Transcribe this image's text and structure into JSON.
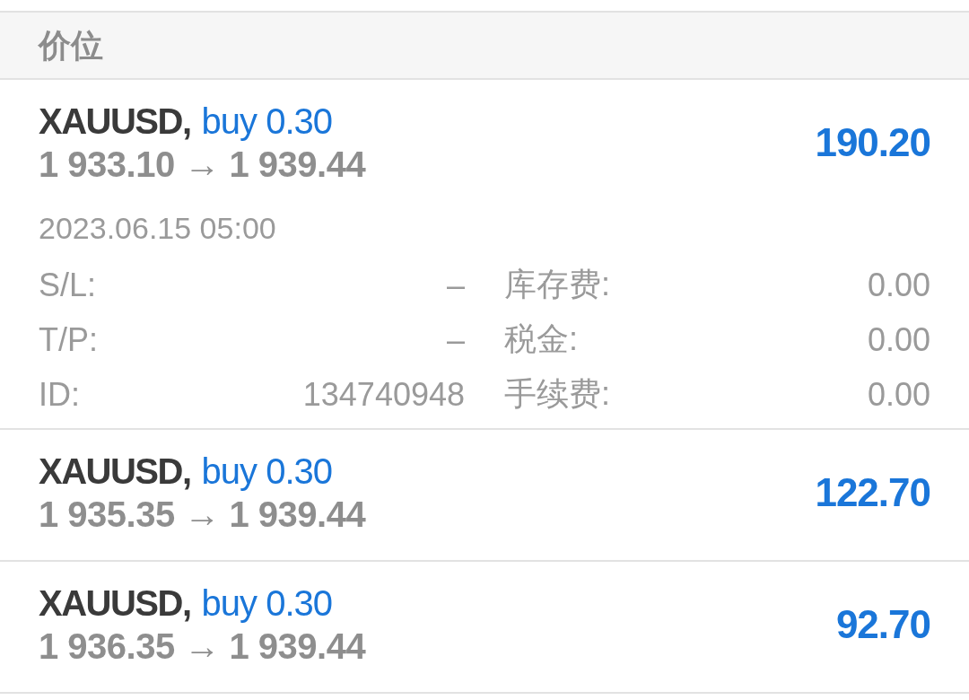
{
  "section": {
    "title": "价位"
  },
  "positions": [
    {
      "symbol": "XAUUSD,",
      "order": "buy 0.30",
      "prices": "1 933.10 → 1 939.44",
      "profit": "190.20",
      "time": "2023.06.15 05:00",
      "details": [
        {
          "label": "S/L:",
          "value": "–"
        },
        {
          "label": "库存费:",
          "value": "0.00"
        },
        {
          "label": "T/P:",
          "value": "–"
        },
        {
          "label": "税金:",
          "value": "0.00"
        },
        {
          "label": "ID:",
          "value": "134740948"
        },
        {
          "label": "手续费:",
          "value": "0.00"
        }
      ]
    },
    {
      "symbol": "XAUUSD,",
      "order": "buy 0.30",
      "prices": "1 935.35 → 1 939.44",
      "profit": "122.70"
    },
    {
      "symbol": "XAUUSD,",
      "order": "buy 0.30",
      "prices": "1 936.35 → 1 939.44",
      "profit": "92.70"
    }
  ]
}
